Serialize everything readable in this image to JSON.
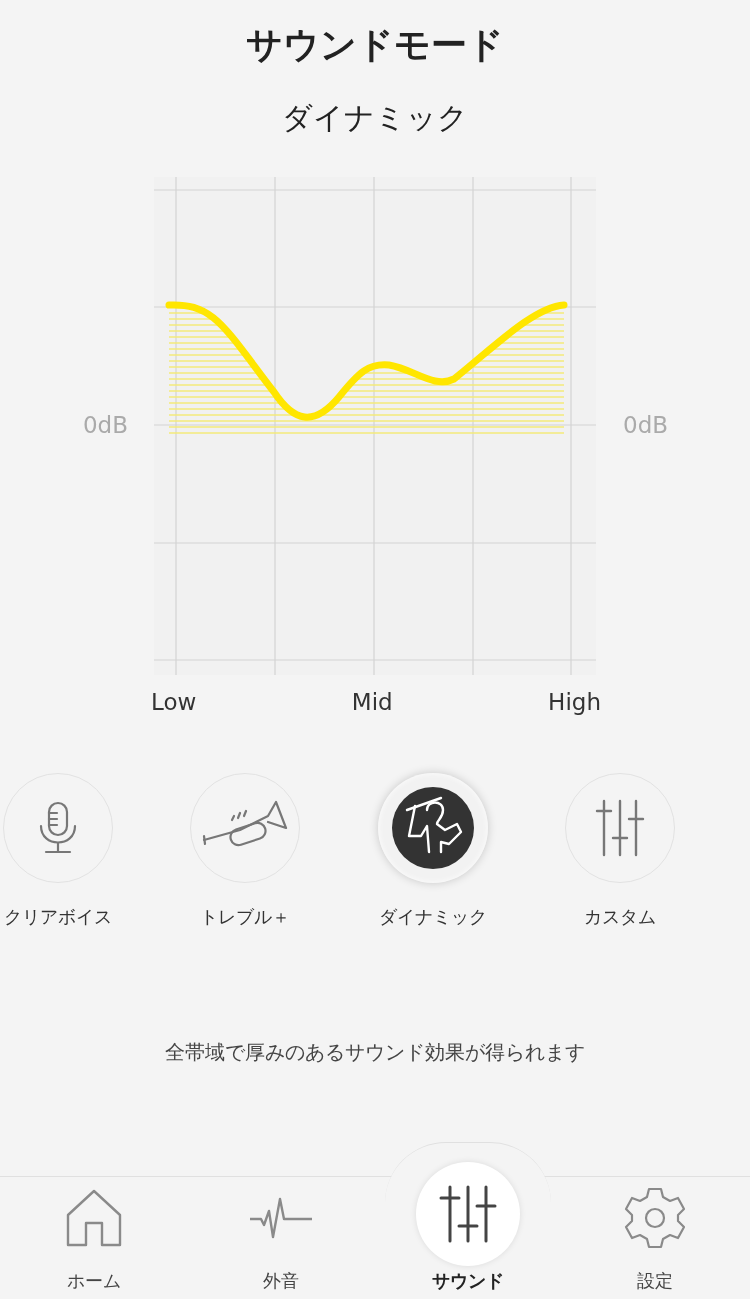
{
  "header": {
    "title": "サウンドモード",
    "current_mode": "ダイナミック"
  },
  "equalizer": {
    "left_label": "0dB",
    "right_label": "0dB",
    "x_labels": [
      "Low",
      "Mid",
      "High"
    ]
  },
  "modes": [
    {
      "label": "クリアボイス",
      "selected": false
    },
    {
      "label": "トレブル＋",
      "selected": false
    },
    {
      "label": "ダイナミック",
      "selected": true
    },
    {
      "label": "カスタム",
      "selected": false
    }
  ],
  "description": "全帯域で厚みのあるサウンド効果が得られます",
  "tabs": [
    {
      "label": "ホーム",
      "selected": false
    },
    {
      "label": "外音",
      "selected": false
    },
    {
      "label": "サウンド",
      "selected": true
    },
    {
      "label": "設定",
      "selected": false
    }
  ]
}
